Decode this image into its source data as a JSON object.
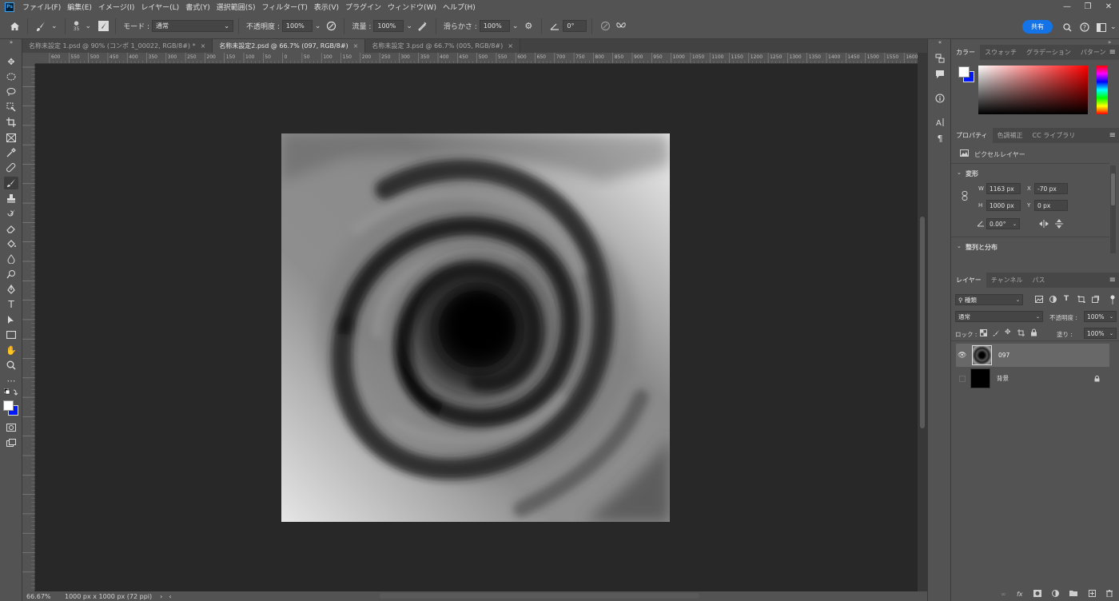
{
  "menu": {
    "items": [
      "ファイル(F)",
      "編集(E)",
      "イメージ(I)",
      "レイヤー(L)",
      "書式(Y)",
      "選択範囲(S)",
      "フィルター(T)",
      "表示(V)",
      "プラグイン",
      "ウィンドウ(W)",
      "ヘルプ(H)"
    ]
  },
  "options": {
    "brush_size": "35",
    "mode_label": "モード :",
    "mode_value": "通常",
    "opacity_label": "不透明度 :",
    "opacity_value": "100%",
    "flow_label": "流量 :",
    "flow_value": "100%",
    "smoothing_label": "滑らかさ :",
    "smoothing_value": "100%",
    "angle_value": "0°",
    "share_label": "共有"
  },
  "tabs": [
    {
      "label": "名称未設定 1.psd @ 90% (コンポ 1_00022, RGB/8#) *",
      "active": false
    },
    {
      "label": "名称未設定2.psd @ 66.7% (097, RGB/8#)",
      "active": true
    },
    {
      "label": "名称未設定 3.psd @ 66.7% (005, RGB/8#)",
      "active": false
    }
  ],
  "ruler_labels": [
    "600",
    "550",
    "500",
    "450",
    "400",
    "350",
    "300",
    "250",
    "200",
    "150",
    "100",
    "50",
    "0",
    "50",
    "100",
    "150",
    "200",
    "250",
    "300",
    "350",
    "400",
    "450",
    "500",
    "550",
    "600",
    "650",
    "700",
    "750",
    "800",
    "850",
    "900",
    "950",
    "1000",
    "1050",
    "1100",
    "1150",
    "1200",
    "1250",
    "1300",
    "1350",
    "1400",
    "1450",
    "1500",
    "1550",
    "1600"
  ],
  "status": {
    "zoom": "66.67%",
    "doc_info": "1000 px x 1000 px (72 ppi)"
  },
  "color_panel": {
    "tabs": [
      "カラー",
      "スウォッチ",
      "グラデーション",
      "パターン"
    ],
    "foreground": "#ffffff",
    "background": "#0018ff"
  },
  "properties_panel": {
    "tabs": [
      "プロパティ",
      "色調補正",
      "CC ライブラリ"
    ],
    "layer_type": "ピクセルレイヤー",
    "transform_title": "変形",
    "w_label": "W",
    "w_value": "1163 px",
    "x_label": "X",
    "x_value": "-70 px",
    "h_label": "H",
    "h_value": "1000 px",
    "y_label": "Y",
    "y_value": "0 px",
    "angle_value": "0.00°",
    "align_title": "整列と分布"
  },
  "layers_panel": {
    "tabs": [
      "レイヤー",
      "チャンネル",
      "パス"
    ],
    "filter_value": "種類",
    "blend_value": "通常",
    "opacity_label": "不透明度 :",
    "opacity_value": "100%",
    "lock_label": "ロック :",
    "fill_label": "塗り :",
    "fill_value": "100%",
    "layers": [
      {
        "name": "097",
        "visible": true,
        "selected": true
      },
      {
        "name": "背景",
        "visible": false,
        "selected": false,
        "locked": true
      }
    ]
  },
  "colors": {
    "accent": "#1473e6",
    "ui_bg": "#535353",
    "workspace_bg": "#282828"
  }
}
